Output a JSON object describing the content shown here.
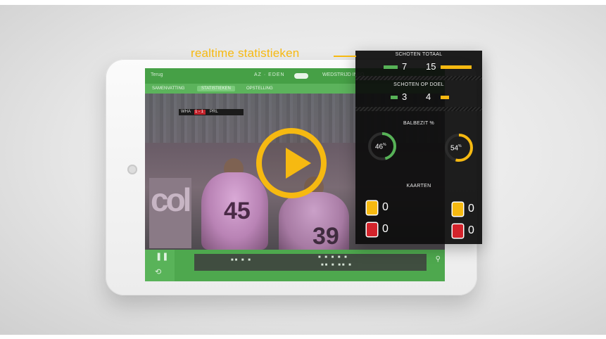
{
  "callout": {
    "label": "realtime statistieken"
  },
  "app": {
    "back_label": "Terug",
    "center_title": "AZ · EDEN",
    "right_label": "WEDSTRIJD INFO",
    "tabs": [
      "SAMENVATTING",
      "STATISTIEKEN",
      "OPSTELLING"
    ]
  },
  "video": {
    "scorebug_home": "WHA",
    "scorebug_score": "1 - 1",
    "scorebug_away": "PRL",
    "board_text": "col",
    "player_numbers": [
      "45",
      "39"
    ]
  },
  "stats": {
    "shots_total": {
      "title": "SCHOTEN TOTAAL",
      "home": "7",
      "away": "15",
      "home_value": 7,
      "away_value": 15
    },
    "shots_on_goal": {
      "title": "SCHOTEN OP DOEL",
      "home": "3",
      "away": "4",
      "home_value": 3,
      "away_value": 4
    },
    "possession": {
      "title": "BALBEZIT %",
      "home": "46",
      "away": "54",
      "unit": "%",
      "home_value": 46,
      "away_value": 54
    },
    "cards": {
      "title": "KAARTEN",
      "home_yellow": "0",
      "home_red": "0",
      "away_yellow": "0",
      "away_red": "0"
    }
  },
  "colors": {
    "home": "#57b257",
    "away": "#f6b911",
    "red_card": "#d3232b",
    "panel_bg": "#0c0c0c",
    "app_green": "#46a046"
  },
  "icons": {
    "play": "play-icon",
    "pause": "pause-icon",
    "replay": "replay-icon",
    "search": "search-icon"
  }
}
